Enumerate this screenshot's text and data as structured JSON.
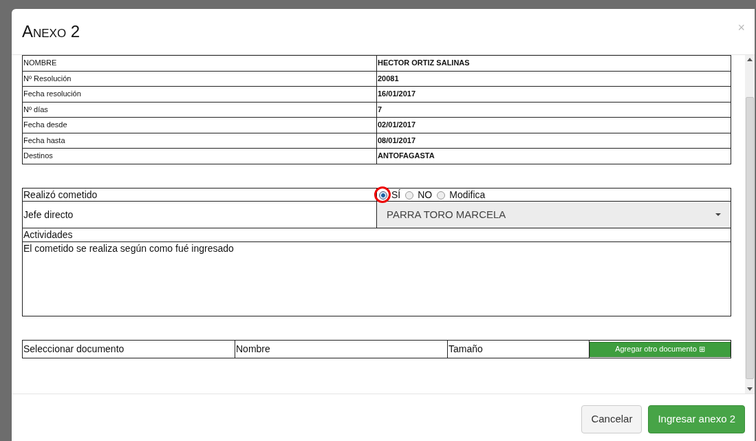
{
  "modal": {
    "title": "Anexo 2",
    "close": "×"
  },
  "details": [
    {
      "label": "NOMBRE",
      "value": "HECTOR ORTIZ SALINAS"
    },
    {
      "label": "Nº Resolución",
      "value": "20081"
    },
    {
      "label": "Fecha resolución",
      "value": "16/01/2017"
    },
    {
      "label": "Nº días",
      "value": "7"
    },
    {
      "label": "Fecha desde",
      "value": "02/01/2017"
    },
    {
      "label": "Fecha hasta",
      "value": "08/01/2017"
    },
    {
      "label": "Destinos",
      "value": "ANTOFAGASTA"
    }
  ],
  "form": {
    "realizo_label": "Realizó cometido",
    "options": [
      {
        "label": "SÍ",
        "selected": true,
        "circled": true
      },
      {
        "label": "NO",
        "selected": false,
        "circled": false
      },
      {
        "label": "Modifica",
        "selected": false,
        "circled": false
      }
    ],
    "jefe_label": "Jefe directo",
    "jefe_value": "PARRA TORO MARCELA",
    "actividades_label": "Actividades",
    "actividades_value": "El cometido se realiza según como fué ingresado"
  },
  "documents": {
    "columns": [
      "Seleccionar documento",
      "Nombre",
      "Tamaño"
    ],
    "add_button": "Agregar otro documento ⊞"
  },
  "buttons": [
    {
      "label": "Cancelar",
      "kind": "secondary"
    },
    {
      "label": "Ingresar anexo 2",
      "kind": "primary"
    }
  ]
}
